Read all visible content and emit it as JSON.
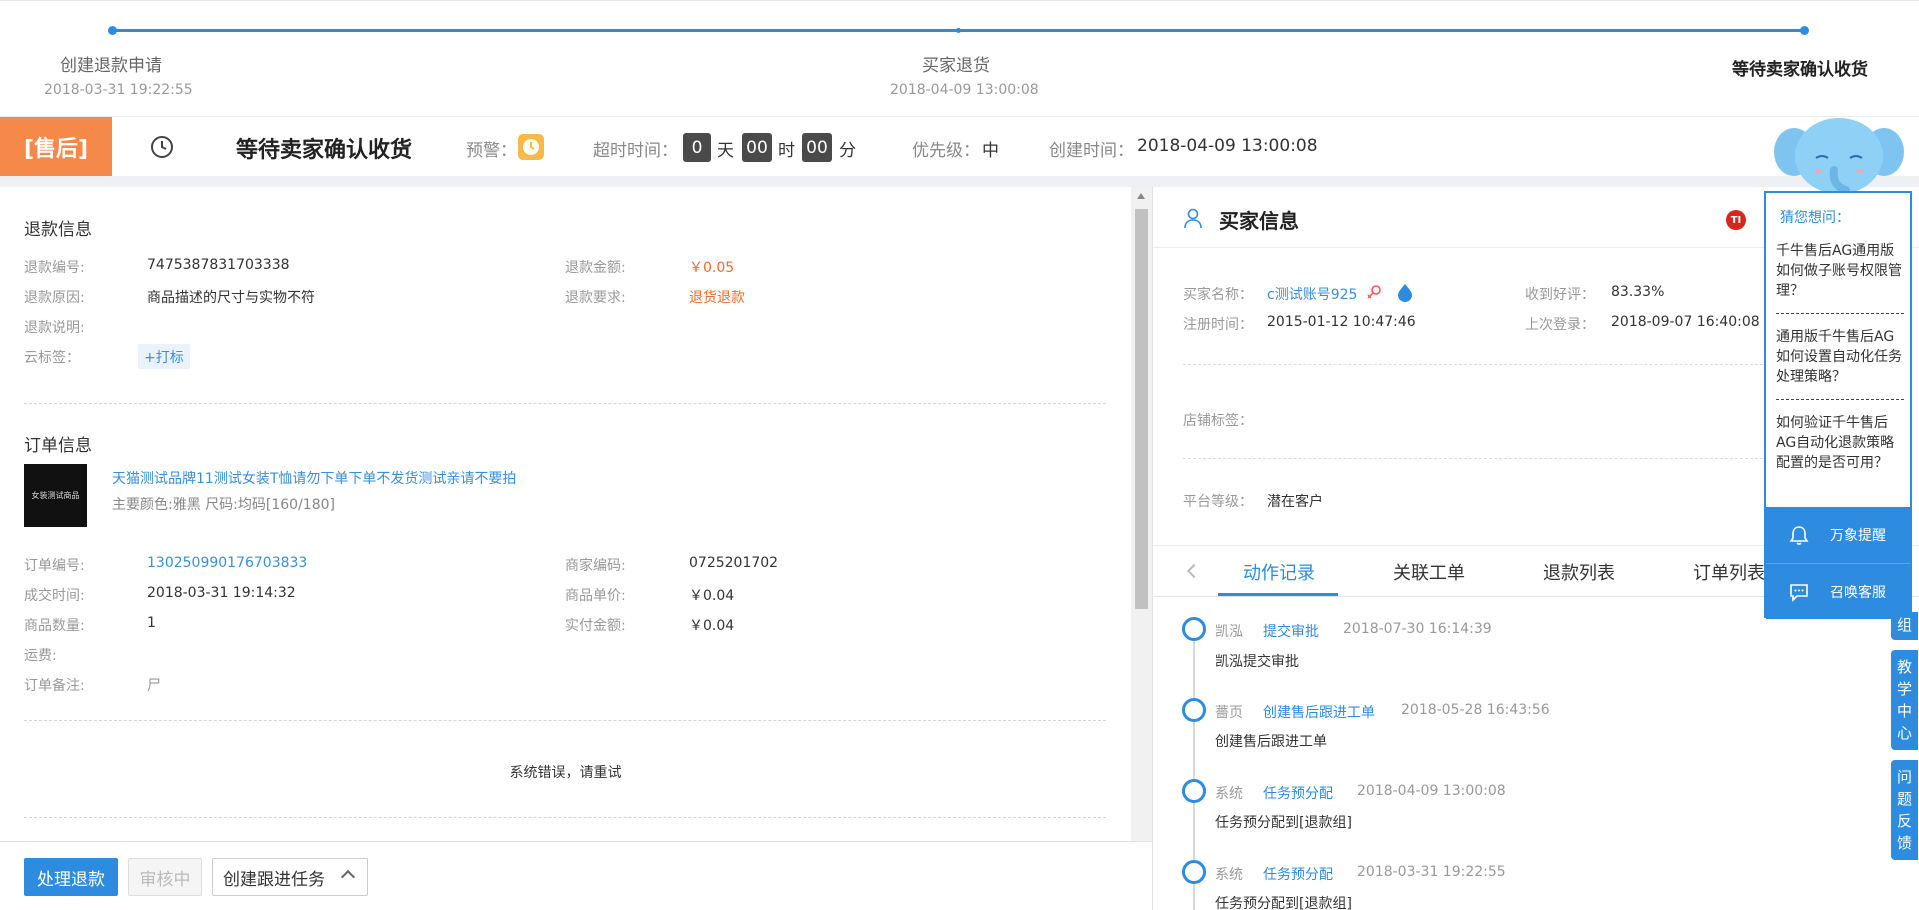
{
  "progress": {
    "steps": [
      {
        "title": "创建退款申请",
        "date": "2018-03-31 19:22:55"
      },
      {
        "title": "买家退货",
        "date": "2018-04-09 13:00:08"
      },
      {
        "title": "等待卖家确认收货",
        "date": ""
      }
    ]
  },
  "status": {
    "badge": "[售后]",
    "title": "等待卖家确认收货",
    "warning_label": "预警：",
    "timeout_label": "超时时间：",
    "days": "0",
    "day_unit": "天",
    "hours": "00",
    "hour_unit": "时",
    "minutes": "00",
    "minute_unit": "分",
    "priority_label": "优先级：",
    "priority": "中",
    "created_label": "创建时间：",
    "created": "2018-04-09 13:00:08"
  },
  "refund": {
    "section_title": "退款信息",
    "id_label": "退款编号:",
    "id": "7475387831703338",
    "amount_label": "退款金额:",
    "amount": "￥0.05",
    "reason_label": "退款原因:",
    "reason": "商品描述的尺寸与实物不符",
    "request_label": "退款要求:",
    "request": "退货退款",
    "note_label": "退款说明:",
    "tags_label": "云标签：",
    "tag_button": "+打标"
  },
  "order": {
    "section_title": "订单信息",
    "thumb_text": "女装测试商品",
    "product_title": "天猫测试品牌11测试女装T恤请勿下单下单不发货测试亲请不要拍",
    "product_spec": "主要颜色:雅黑 尺码:均码[160/180]",
    "order_no_label": "订单编号:",
    "order_no": "130250990176703833",
    "merchant_code_label": "商家编码:",
    "merchant_code": "0725201702",
    "deal_time_label": "成交时间:",
    "deal_time": "2018-03-31 19:14:32",
    "unit_price_label": "商品单价:",
    "unit_price": "￥0.04",
    "qty_label": "商品数量:",
    "qty": "1",
    "paid_label": "实付金额:",
    "paid": "￥0.04",
    "shipping_label": "运费:",
    "remark_label": "订单备注:",
    "remark": "尸",
    "error_msg": "系统错误，请重试"
  },
  "actions": {
    "process": "处理退款",
    "reviewing": "审核中",
    "create_task": "创建跟进任务"
  },
  "buyer": {
    "title": "买家信息",
    "name_label": "买家名称：",
    "name": "c测试账号925",
    "praise_label": "收到好评：",
    "praise": "83.33%",
    "reg_label": "注册时间：",
    "reg": "2015-01-12 10:47:46",
    "last_login_label": "上次登录：",
    "last_login": "2018-09-07 16:40:08",
    "shop_tag_label": "店铺标签：",
    "level_label": "平台等级：",
    "level": "潜在客户",
    "mini_badge": "TI"
  },
  "tabs": [
    "动作记录",
    "关联工单",
    "退款列表",
    "订单列表"
  ],
  "timeline": [
    {
      "actor": "凯泓",
      "action": "提交审批",
      "time": "2018-07-30 16:14:39",
      "desc": "凯泓提交审批"
    },
    {
      "actor": "薔页",
      "action": "创建售后跟进工单",
      "time": "2018-05-28 16:43:56",
      "desc": "创建售后跟进工单"
    },
    {
      "actor": "系统",
      "action": "任务预分配",
      "time": "2018-04-09 13:00:08",
      "desc": "任务预分配到[退款组]"
    },
    {
      "actor": "系统",
      "action": "任务预分配",
      "time": "2018-03-31 19:22:55",
      "desc": "任务预分配到[退款组]"
    }
  ],
  "assistant": {
    "title": "猜您想问：",
    "questions": [
      "千牛售后AG通用版如何做子账号权限管理？",
      "通用版千牛售后AG如何设置自动化任务处理策略？",
      "如何验证千牛售后AG自动化退款策略配置的是否可用？"
    ],
    "remind_button": "万象提醒",
    "service_button": "召唤客服"
  },
  "side_tabs": {
    "group": "组",
    "teaching": "教学中心",
    "feedback": "问题反馈"
  },
  "colors": {
    "accent": "#2d8ce0",
    "orange_badge": "#f5894a",
    "amount": "#f46c2b"
  }
}
